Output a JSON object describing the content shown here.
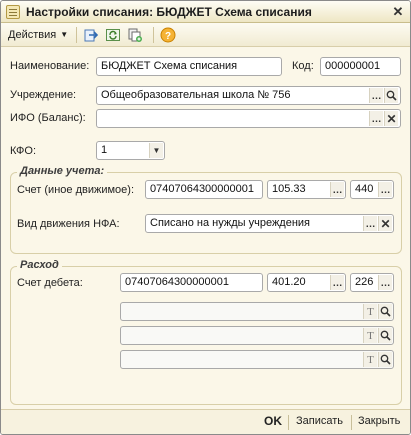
{
  "window": {
    "title": "Настройки списания: БЮДЖЕТ Схема списания",
    "close_symbol": "✕"
  },
  "toolbar": {
    "actions_label": "Действия",
    "icons": [
      "save-and-close-icon",
      "refresh-icon",
      "copy-icon",
      "help-icon"
    ]
  },
  "form": {
    "name_label": "Наименование:",
    "name_value": "БЮДЖЕТ Схема списания",
    "code_label": "Код:",
    "code_value": "000000001",
    "institution_label": "Учреждение:",
    "institution_value": "Общеобразовательная школа № 756",
    "ifo_label": "ИФО (Баланс):",
    "ifo_value": "",
    "kfo_label": "КФО:",
    "kfo_value": "1"
  },
  "accounting": {
    "group_title": "Данные учета:",
    "account_label": "Счет (иное движимое):",
    "account_main": "07407064300000001",
    "account_sub": "105.33",
    "account_kosgu": "440",
    "movement_label": "Вид движения НФА:",
    "movement_value": "Списано на нужды учреждения"
  },
  "expense": {
    "group_title": "Расход",
    "debit_label": "Счет дебета:",
    "debit_main": "07407064300000001",
    "debit_sub": "401.20",
    "debit_kosgu": "226",
    "analytics": [
      "",
      "",
      ""
    ]
  },
  "footer": {
    "ok_label": "OK",
    "save_label": "Записать",
    "close_label": "Закрыть"
  },
  "colors": {
    "window_bg": "#fbf7e8",
    "help_icon": "#e8a317"
  }
}
